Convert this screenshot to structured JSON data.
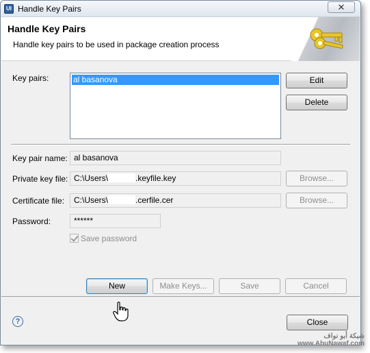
{
  "window": {
    "title": "Handle Key Pairs",
    "close_glyph": "✕"
  },
  "header": {
    "title": "Handle Key Pairs",
    "description": "Handle key pairs to be used in package creation process",
    "icon": "keys-icon"
  },
  "key_pairs": {
    "label": "Key pairs:",
    "items": [
      "al basanova"
    ],
    "selected_index": 0,
    "edit_button": "Edit",
    "delete_button": "Delete"
  },
  "form": {
    "key_pair_name_label": "Key pair name:",
    "key_pair_name_value": "al basanova",
    "private_key_label": "Private key file:",
    "private_key_prefix": "C:\\Users\\",
    "private_key_suffix": ".keyfile.key",
    "private_key_browse": "Browse...",
    "certificate_label": "Certificate file:",
    "certificate_prefix": "C:\\Users\\",
    "certificate_suffix": ".cerfile.cer",
    "certificate_browse": "Browse...",
    "password_label": "Password:",
    "password_value": "******",
    "save_password_label": "Save password",
    "save_password_checked": true
  },
  "actions": {
    "new": "New",
    "make_keys": "Make Keys...",
    "save": "Save",
    "cancel": "Cancel"
  },
  "footer": {
    "help_glyph": "?",
    "close": "Close"
  },
  "watermark": {
    "line1": "شبكة أبو نواف",
    "line2": "www.AbuNawaf.com"
  },
  "colors": {
    "selection": "#3399ff",
    "banner": "#ffffff",
    "dialog_bg": "#f0f0f0"
  }
}
